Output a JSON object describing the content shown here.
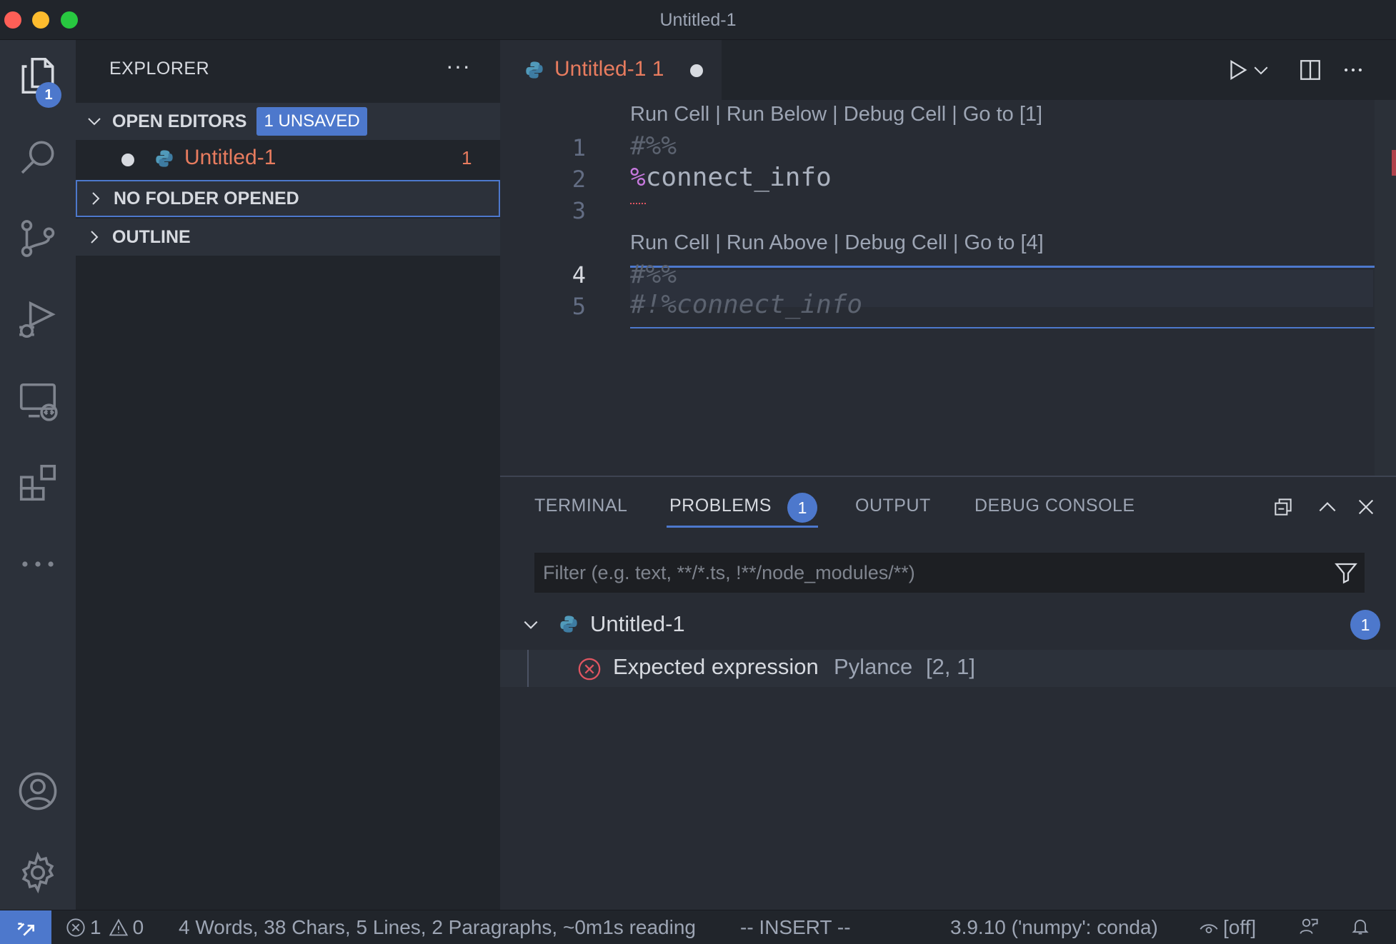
{
  "window": {
    "title": "Untitled-1"
  },
  "activity_bar": {
    "explorer_badge": "1"
  },
  "sidebar": {
    "title": "EXPLORER",
    "more": "···",
    "open_editors": {
      "label": "OPEN EDITORS",
      "badge": "1 UNSAVED"
    },
    "open_file": {
      "name": "Untitled-1",
      "problems": "1"
    },
    "no_folder": {
      "label": "NO FOLDER OPENED"
    },
    "outline": {
      "label": "OUTLINE"
    }
  },
  "editor": {
    "tab": {
      "label": "Untitled-1",
      "problems": "1"
    },
    "lens_1": "Run Cell | Run Below | Debug Cell | Go to [1]",
    "lens_2": "Run Cell | Run Above | Debug Cell | Go to [4]",
    "line_numbers": [
      "1",
      "2",
      "3",
      "4",
      "5"
    ],
    "lines": {
      "l1": "#%%",
      "l2_magic": "%",
      "l2_rest": "connect_info",
      "l4": "#%%",
      "l5": "#!%connect_info"
    }
  },
  "panel": {
    "tabs": {
      "terminal": "TERMINAL",
      "problems": "PROBLEMS",
      "output": "OUTPUT",
      "debug_console": "DEBUG CONSOLE"
    },
    "problems_badge": "1",
    "filter_placeholder": "Filter (e.g. text, **/*.ts, !**/node_modules/**)",
    "problem_file": {
      "name": "Untitled-1",
      "count": "1"
    },
    "problem": {
      "message": "Expected expression",
      "source": "Pylance",
      "location": "[2, 1]"
    }
  },
  "status_bar": {
    "errors": "1",
    "warnings": "0",
    "word_count": "4 Words, 38 Chars, 5 Lines, 2 Paragraphs, ~0m1s reading",
    "mode": "-- INSERT --",
    "interpreter": "3.9.10 ('numpy': conda)",
    "watch": "[off]"
  },
  "colors": {
    "accent": "#4d78cc",
    "modified_file": "#e87c5f",
    "error": "#e05561",
    "background": "#282c34",
    "sidebar": "#21252b"
  }
}
